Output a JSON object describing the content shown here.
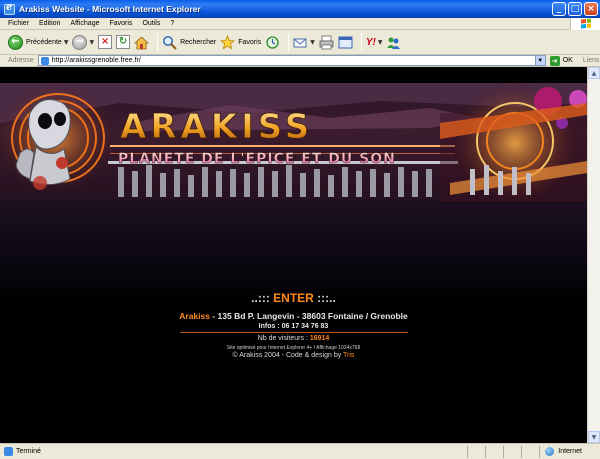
{
  "window": {
    "title": "Arakiss Website - Microsoft Internet Explorer",
    "min": "_",
    "max": "□",
    "close": "×"
  },
  "menu": [
    "Fichier",
    "Edition",
    "Affichage",
    "Favoris",
    "Outils",
    "?"
  ],
  "toolbar": {
    "back_label": "Précédente",
    "search_label": "Rechercher",
    "favorites_label": "Favoris",
    "yahoo_label": "Y!"
  },
  "address": {
    "label": "Adresse",
    "url": "http://arakissgrenoble.free.fr/",
    "go_label": "OK",
    "links_label": "Liens"
  },
  "page": {
    "banner_title": "ARAKISS",
    "banner_subtitle": "PLANETE DE L'EPICE ET DU SON",
    "enter_prefix": "..::: ",
    "enter_label": "ENTER",
    "enter_suffix": " :::..",
    "brand": "Arakiss",
    "address_text": " - 135 Bd P. Langevin - 38603 Fontaine / Grenoble",
    "infos": "Infos : 06 17 34 76 83",
    "visitors_label": "Nb de visiteurs : ",
    "visitors_count": "16914",
    "optimized": "Site optimisé pour Internet Explorer 4+ / Affichage 1024x768",
    "copyright": "© Arakiss 2004 - Code & design by ",
    "designer": "Tris"
  },
  "status": {
    "text": "Terminé",
    "zone": "Internet"
  },
  "colors": {
    "accent": "#ff8a1c",
    "xp_blue": "#0a5ee9",
    "chrome": "#ece9d8"
  },
  "icons": [
    "ie-icon",
    "back-arrow-icon",
    "forward-arrow-icon",
    "stop-icon",
    "refresh-icon",
    "home-icon",
    "search-icon",
    "favorites-star-icon",
    "history-icon",
    "mail-icon",
    "print-icon",
    "edit-icon",
    "messenger-icon",
    "globe-icon",
    "windows-flag-icon"
  ]
}
